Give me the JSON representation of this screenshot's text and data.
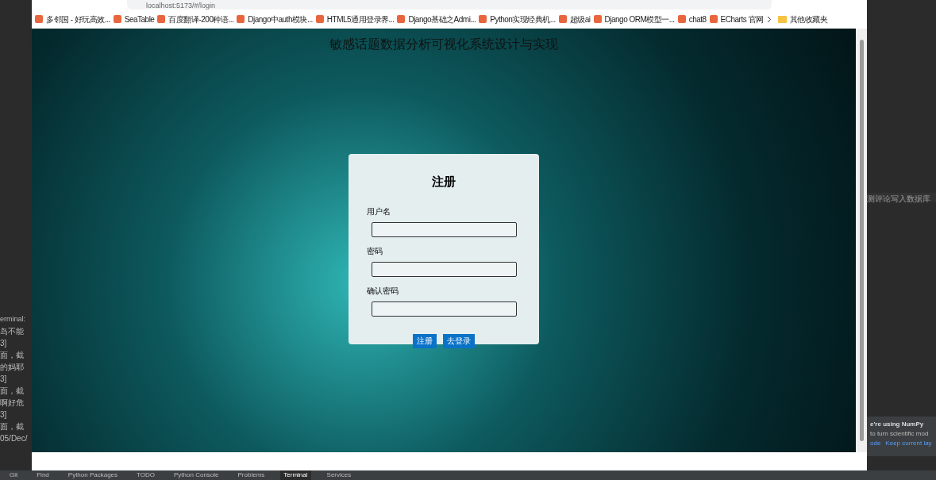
{
  "ide_left": {
    "terminal_label": "erminal:",
    "lines": [
      "岛不能",
      "3]",
      "面，截",
      "的妈耶",
      "3]",
      "面，截",
      "啊好危",
      "3]",
      "面，截",
      "05/Dec/"
    ]
  },
  "browser": {
    "address": "localhost:5173/#/login",
    "bookmarks": [
      "多邻国 - 好玩高效...",
      "SeaTable",
      "百度翻译-200种语...",
      "Django中auth模块...",
      "HTML5通用登录界...",
      "Django基础之Admi...",
      "Python实现经典机...",
      "超级ai",
      "Django ORM模型一...",
      "chat8",
      "ECharts 官网"
    ],
    "other_bookmarks": "其他收藏夹",
    "page": {
      "title": "敏感话题数据分析可视化系统设计与实现",
      "form": {
        "heading": "注册",
        "fields": [
          {
            "label": "用户名"
          },
          {
            "label": "密码"
          },
          {
            "label": "确认密码"
          }
        ],
        "buttons": [
          "注册",
          "去登录"
        ]
      }
    }
  },
  "ide_right": {
    "editor_line": "测评论写入数据库",
    "notice_title": "e're using NumPy",
    "notice_text": "to turn scientific mod",
    "notice_links": [
      "ode",
      "Keep current lay"
    ]
  },
  "tool_tabs": [
    {
      "label": "Git",
      "selected": false
    },
    {
      "label": "Find",
      "selected": false
    },
    {
      "label": "Python Packages",
      "selected": false
    },
    {
      "label": "TODO",
      "selected": false
    },
    {
      "label": "Python Console",
      "selected": false
    },
    {
      "label": "Problems",
      "selected": false
    },
    {
      "label": "Terminal",
      "selected": true
    },
    {
      "label": "Services",
      "selected": false
    }
  ]
}
